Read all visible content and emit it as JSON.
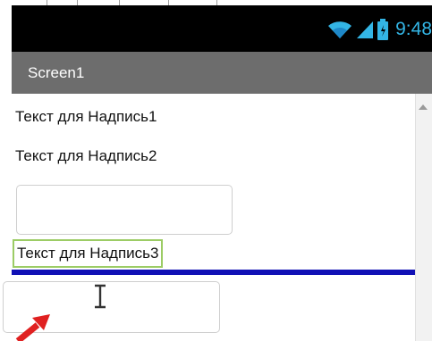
{
  "status_bar": {
    "time": "9:48",
    "icons": [
      "wifi-icon",
      "signal-icon",
      "battery-icon"
    ],
    "accent_color": "#33b5e5"
  },
  "screen": {
    "title": "Screen1",
    "title_bar_color": "#6d6d6d"
  },
  "components": {
    "label1": "Текст для Надпись1",
    "label2": "Текст для Надпись2",
    "textbox1_value": "",
    "label3": "Текст для Надпись3",
    "textbox2_value": ""
  },
  "colors": {
    "divider_line": "#1010b5",
    "selection_border": "#9ccc65",
    "annotation_arrow": "#e02020"
  }
}
